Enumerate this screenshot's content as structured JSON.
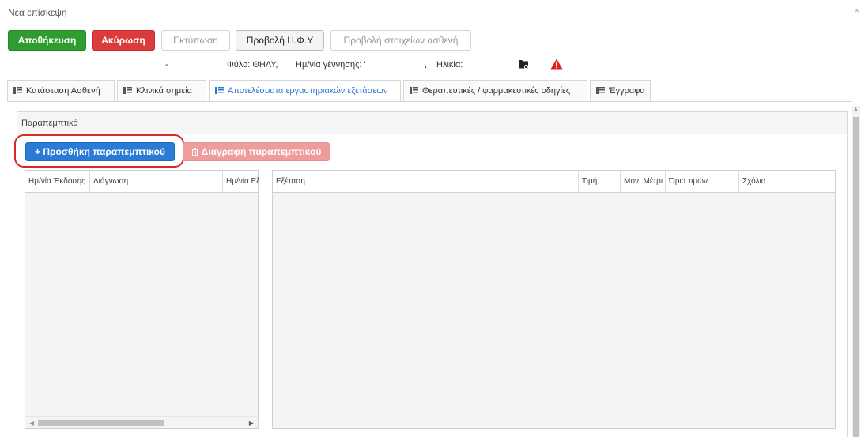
{
  "window": {
    "title": "Νέα επίσκεψη",
    "close_label": "×"
  },
  "toolbar": {
    "save_label": "Αποθήκευση",
    "cancel_label": "Ακύρωση",
    "print_label": "Εκτύπωση",
    "ehr_label": "Προβολή Η.Φ.Υ",
    "patient_label": "Προβολή στοιχείων ασθενή"
  },
  "patient_info": {
    "dash": "-",
    "sex": "Φύλο: ΘΗΛΥ,",
    "dob": "Ημ/νία γέννησης: '",
    "dob_sep": ",",
    "age": "Ηλικία:"
  },
  "tabs": [
    {
      "label": "Κατάσταση Ασθενή",
      "active": false
    },
    {
      "label": "Κλινικά σημεία",
      "active": false
    },
    {
      "label": "Αποτελέσματα εργαστηριακών εξετάσεων",
      "active": true
    },
    {
      "label": "Θεραπευτικές / φαρμακευτικές οδηγίες",
      "active": false
    },
    {
      "label": "Έγγραφα",
      "active": false
    }
  ],
  "panel": {
    "title": "Παραπεμπτικά",
    "add_label": "+ Προσθήκη παραπεμπτικού",
    "delete_label": "Διαγραφή παραπεμπτικού"
  },
  "referrals_table": {
    "columns": [
      "Ημ/νία Έκδοσης",
      "Διάγνωση",
      "Ημ/νία Εξ"
    ]
  },
  "exams_table": {
    "columns": [
      "Εξέταση",
      "Τιμή",
      "Μον. Μέτρι",
      "Όρια τιμών",
      "Σχόλια"
    ]
  },
  "colors": {
    "save": "#2e9c2e",
    "cancel": "#dc3b3b",
    "primary": "#2a7bd6",
    "danger_disabled": "#ee9c9c",
    "active_tab": "#2f79c8",
    "highlight": "#d42a2a"
  },
  "icons": {
    "folder": "folder-settings-icon",
    "warning": "warning-icon",
    "tab": "list-icon",
    "trash": "trash-icon"
  }
}
